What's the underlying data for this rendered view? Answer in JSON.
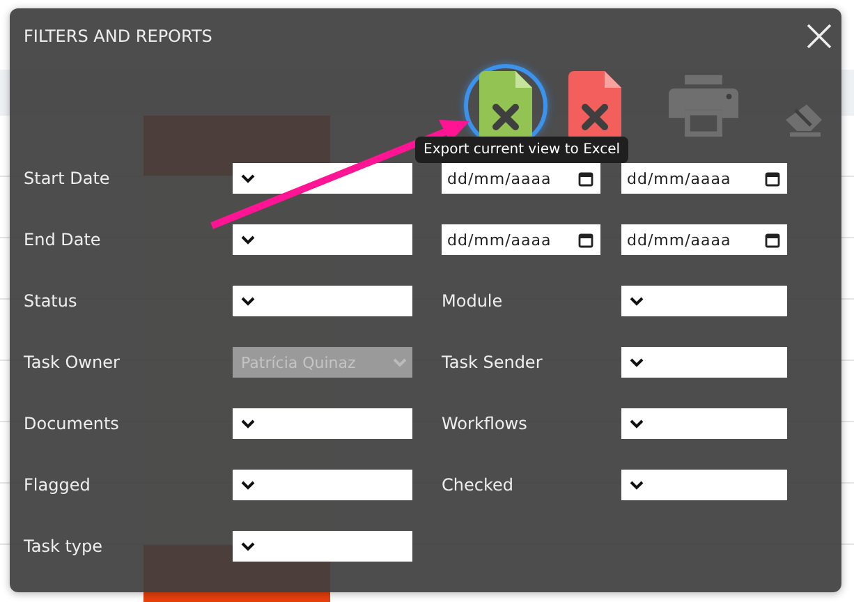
{
  "dialog": {
    "title": "FILTERS AND REPORTS",
    "actions": [
      {
        "kind": "excel",
        "highlighted": true
      },
      {
        "kind": "pdf",
        "highlighted": false
      },
      {
        "kind": "print",
        "highlighted": false
      },
      {
        "kind": "clear",
        "highlighted": false
      }
    ],
    "tooltip": "Export current view to Excel",
    "rows": [
      [
        {
          "kind": "label",
          "text": "Start Date"
        },
        {
          "kind": "select",
          "disabled": false
        },
        {
          "kind": "date",
          "placeholder": "dd/mm/aaaa"
        },
        {
          "kind": "date",
          "placeholder": "dd/mm/aaaa"
        }
      ],
      [
        {
          "kind": "label",
          "text": "End Date"
        },
        {
          "kind": "select",
          "disabled": false
        },
        {
          "kind": "date",
          "placeholder": "dd/mm/aaaa"
        },
        {
          "kind": "date",
          "placeholder": "dd/mm/aaaa"
        }
      ],
      [
        {
          "kind": "label",
          "text": "Status"
        },
        {
          "kind": "select",
          "disabled": false
        },
        {
          "kind": "label",
          "text": "Module"
        },
        {
          "kind": "select",
          "disabled": false
        }
      ],
      [
        {
          "kind": "label",
          "text": "Task Owner"
        },
        {
          "kind": "select",
          "value": "Patrícia Quinaz",
          "disabled": true
        },
        {
          "kind": "label",
          "text": "Task Sender"
        },
        {
          "kind": "select",
          "disabled": false
        }
      ],
      [
        {
          "kind": "label",
          "text": "Documents"
        },
        {
          "kind": "select",
          "disabled": false
        },
        {
          "kind": "label",
          "text": "Workflows"
        },
        {
          "kind": "select",
          "disabled": false
        }
      ],
      [
        {
          "kind": "label",
          "text": "Flagged"
        },
        {
          "kind": "select",
          "disabled": false
        },
        {
          "kind": "label",
          "text": "Checked"
        },
        {
          "kind": "select",
          "disabled": false
        }
      ],
      [
        {
          "kind": "label",
          "text": "Task type"
        },
        {
          "kind": "select",
          "disabled": false
        }
      ]
    ]
  }
}
